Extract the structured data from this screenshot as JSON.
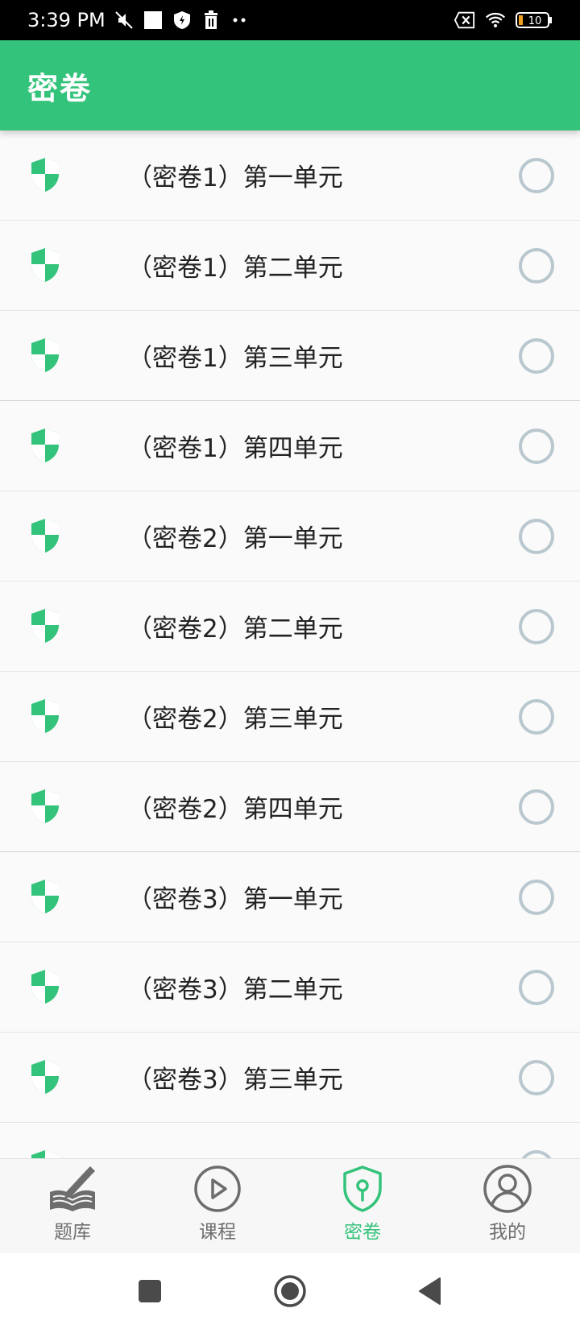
{
  "status_bar": {
    "time": "3:39 PM",
    "battery": "10"
  },
  "app_bar": {
    "title": "密卷"
  },
  "list": {
    "items": [
      {
        "label": "（密卷1）第一单元"
      },
      {
        "label": "（密卷1）第二单元"
      },
      {
        "label": "（密卷1）第三单元"
      },
      {
        "label": "（密卷1）第四单元"
      },
      {
        "label": "（密卷2）第一单元"
      },
      {
        "label": "（密卷2）第二单元"
      },
      {
        "label": "（密卷2）第三单元"
      },
      {
        "label": "（密卷2）第四单元"
      },
      {
        "label": "（密卷3）第一单元"
      },
      {
        "label": "（密卷3）第二单元"
      },
      {
        "label": "（密卷3）第三单元"
      }
    ]
  },
  "bottom_nav": {
    "items": [
      {
        "label": "题库"
      },
      {
        "label": "课程"
      },
      {
        "label": "密卷"
      },
      {
        "label": "我的"
      }
    ],
    "active_index": 2
  },
  "colors": {
    "accent": "#33c37a",
    "radio": "#b9c7cf"
  }
}
